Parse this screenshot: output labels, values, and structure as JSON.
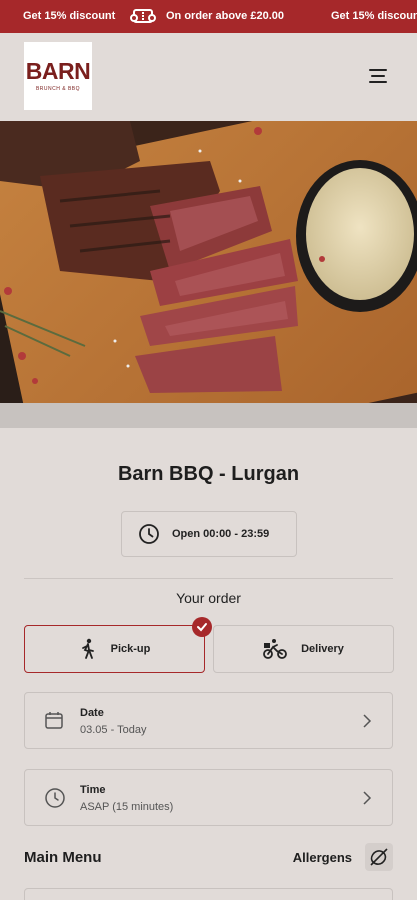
{
  "promo": {
    "text1": "Get 15% discount",
    "text2": "On order above £20.00",
    "text3": "Get 15% discount",
    "icon": "ticket-icon"
  },
  "brand": {
    "logo_word": "BARN",
    "logo_sub": "BRUNCH & BBQ"
  },
  "header": {
    "menu_icon": "hamburger-icon"
  },
  "hero": {
    "alt": "Sliced steak with sauce"
  },
  "store": {
    "name": "Barn BBQ - Lurgan",
    "hours": "Open 00:00 - 23:59"
  },
  "order": {
    "heading": "Your order",
    "options": [
      {
        "label": "Pick-up",
        "icon": "walking-person-icon",
        "selected": true
      },
      {
        "label": "Delivery",
        "icon": "bicycle-delivery-icon",
        "selected": false
      }
    ]
  },
  "date": {
    "label": "Date",
    "value": "03.05 - Today"
  },
  "time": {
    "label": "Time",
    "value": "ASAP (15 minutes)"
  },
  "menu": {
    "title": "Main Menu",
    "allergens": "Allergens"
  },
  "colors": {
    "accent": "#a6282a",
    "background": "#e1dbd8"
  }
}
